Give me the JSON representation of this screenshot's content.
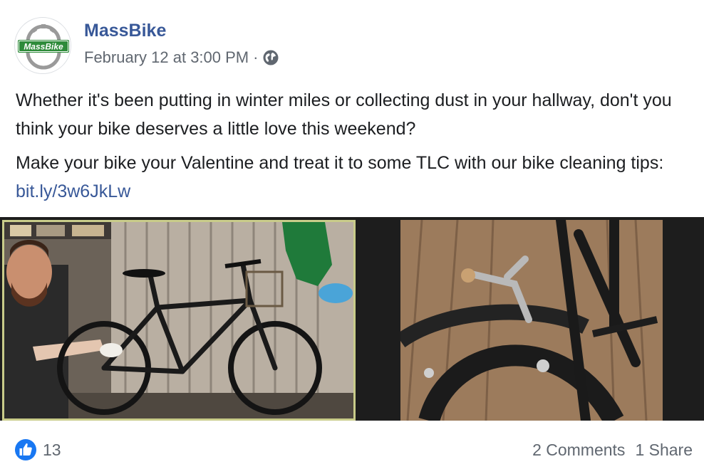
{
  "post": {
    "page_name": "MassBike",
    "avatar_text": "MassBike",
    "timestamp": "February 12 at 3:00 PM",
    "separator": "·",
    "privacy_icon": "globe-icon",
    "text_paragraph_1": "Whether it's been putting in winter miles or collecting dust in your hallway, don't you think your bike deserves a little love this weekend?",
    "text_paragraph_2_prefix": "Make your bike your Valentine and treat it to some TLC with our bike cleaning tips: ",
    "link_text": "bit.ly/3w6JkLw"
  },
  "media": {
    "left_image": "video-call-person-cleaning-bike",
    "right_image": "bike-brake-closeup"
  },
  "footer": {
    "reaction_icon": "like-icon",
    "reaction_count": "13",
    "comments": "2 Comments",
    "shares": "1 Share"
  },
  "colors": {
    "brand_link": "#385898",
    "secondary_text": "#606770",
    "like_blue": "#1877f2",
    "logo_green": "#2e8b3a"
  }
}
